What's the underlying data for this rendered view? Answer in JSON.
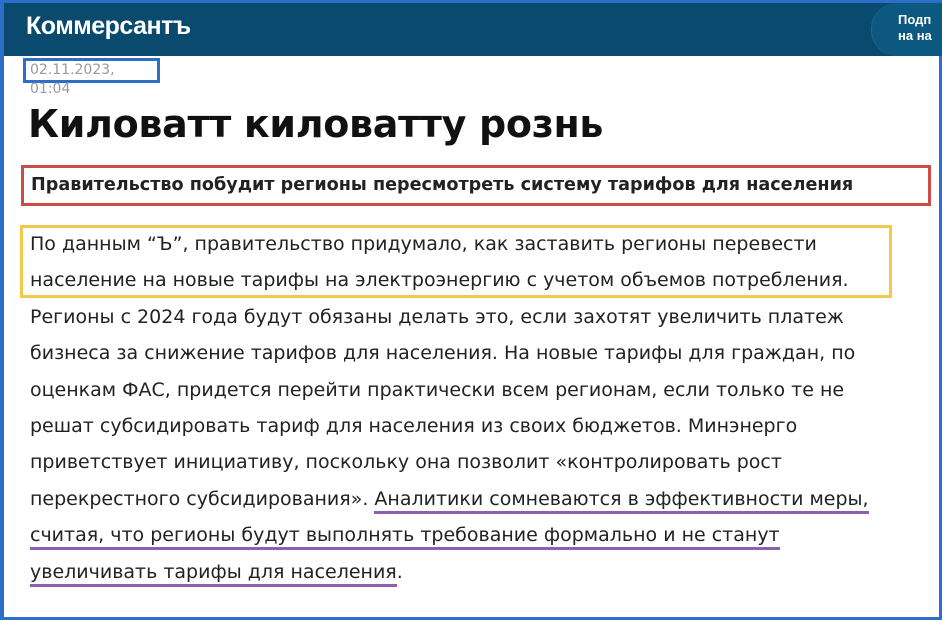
{
  "header": {
    "logo": "Коммерсантъ",
    "subscribe_text": "Подп\nна на"
  },
  "article": {
    "date": "02.11.2023, 01:04",
    "title": "Киловатт киловатту рознь",
    "subtitle": "Правительство побудит регионы пересмотреть систему тарифов для населения",
    "body_lines": [
      "По данным “Ъ”, правительство придумало, как заставить регионы перевести",
      "население на новые тарифы на электроэнергию с учетом объемов потребления.",
      "Регионы с 2024 года будут обязаны делать это, если захотят увеличить платеж",
      "бизнеса за снижение тарифов для населения. На новые тарифы для граждан, по",
      "оценкам ФАС, придется перейти практически всем регионам, если только те не",
      "решат субсидировать тариф для населения из своих бюджетов. Минэнерго",
      "приветствует инициативу, поскольку она позволит «контролировать рост"
    ],
    "line8_plain": "перекрестного субсидирования». ",
    "line8_highlight": "Аналитики сомневаются в эффективности меры,",
    "line9_highlight": "считая, что регионы будут выполнять требование формально и не станут",
    "line10_highlight": "увеличивать тарифы для населения",
    "line10_tail": "."
  },
  "colors": {
    "header_bg": "#0a4a6f",
    "frame_blue": "#2d6fc7",
    "subtitle_red": "#cf4b48",
    "lead_yellow": "#f2c94c",
    "highlight_purple": "#8e5fb0"
  }
}
